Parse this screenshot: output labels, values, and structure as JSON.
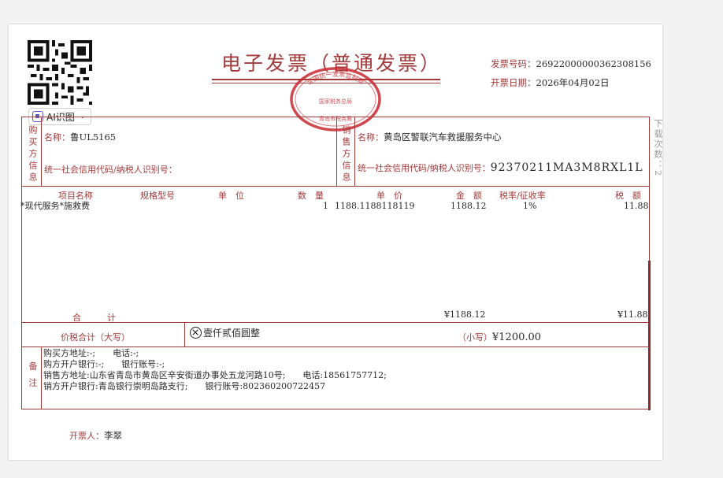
{
  "invoice": {
    "title": "电子发票（普通发票）",
    "stamp_text": {
      "outer": "全国统一发票监制章",
      "middle": "国家税务总局",
      "bottom": "青岛市税务局"
    },
    "number_label": "发票号码：",
    "number": "26922000000362308156",
    "date_label": "开票日期：",
    "date": "2026年04月02日",
    "download_count": "下载次数：2"
  },
  "ai_button": {
    "label": "AI识图"
  },
  "buyer": {
    "section_label": "购买方信息",
    "name_label": "名称：",
    "name": "鲁UL5165",
    "tax_id_label": "统一社会信用代码/纳税人识别号：",
    "tax_id": ""
  },
  "seller": {
    "section_label": "销售方信息",
    "name_label": "名称：",
    "name": "黄岛区警联汽车救援服务中心",
    "tax_id_label": "统一社会信用代码/纳税人识别号：",
    "tax_id": "92370211MA3M8RXL1L"
  },
  "items": {
    "headers": [
      "项目名称",
      "规格型号",
      "单　位",
      "数　量",
      "单　价",
      "金　额",
      "税率/征收率",
      "税　额"
    ],
    "rows": [
      {
        "name": "*现代服务*施救费",
        "spec": "",
        "unit": "",
        "qty": "1",
        "price": "1188.1188118119",
        "amount": "1188.12",
        "rate": "1%",
        "tax": "11.88"
      }
    ],
    "subtotal_label": "合　　　计",
    "subtotal_amount": "¥1188.12",
    "subtotal_tax": "¥11.88"
  },
  "total": {
    "label": "价税合计（大写）",
    "uppercase": "壹仟贰佰圆整",
    "small_label": "（小写）",
    "small": "¥1200.00"
  },
  "remarks": {
    "label": "备注",
    "lines": [
      "购买方地址:-;　　电话:-;",
      "购方开户银行:-;　　银行账号:-;",
      "销售方地址:山东省青岛市黄岛区辛安街道办事处五龙河路10号;　　电话:18561757712;",
      "销方开户银行:青岛银行崇明岛路支行;　　银行账号:802360200722457"
    ]
  },
  "issuer": {
    "label": "开票人：",
    "name": "李翠"
  }
}
